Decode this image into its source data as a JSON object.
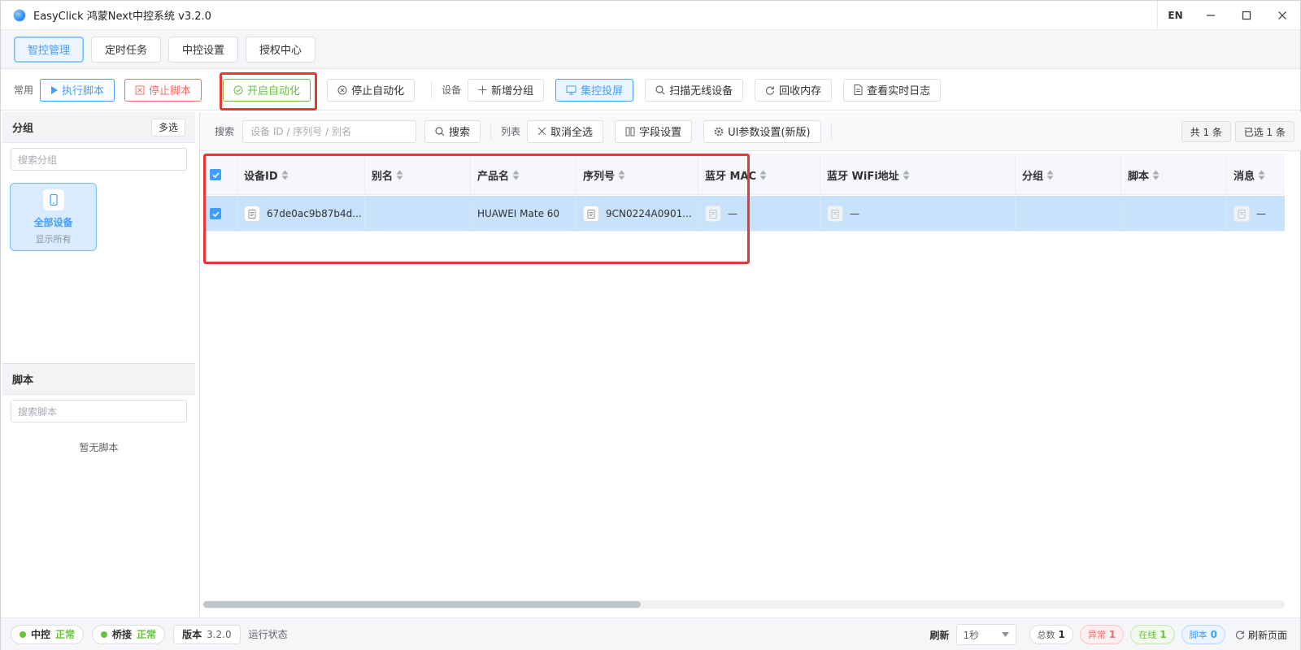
{
  "window": {
    "title": "EasyClick 鸿蒙Next中控系统 v3.2.0",
    "lang": "EN"
  },
  "nav": {
    "tabs": [
      {
        "label": "智控管理",
        "active": true
      },
      {
        "label": "定时任务"
      },
      {
        "label": "中控设置"
      },
      {
        "label": "授权中心"
      }
    ]
  },
  "toolbar": {
    "common_label": "常用",
    "run_script": "执行脚本",
    "stop_script": "停止脚本",
    "start_auto": "开启自动化",
    "stop_auto": "停止自动化",
    "device_label": "设备",
    "add_group": "新增分组",
    "group_screen": "集控投屏",
    "scan_wireless": "扫描无线设备",
    "reclaim_memory": "回收内存",
    "view_logs": "查看实时日志"
  },
  "sidebar": {
    "group_title": "分组",
    "multi_select": "多选",
    "group_search_placeholder": "搜索分组",
    "group_card": {
      "name": "全部设备",
      "sub": "显示所有"
    },
    "script_title": "脚本",
    "script_search_placeholder": "搜索脚本",
    "script_empty": "暂无脚本"
  },
  "filter": {
    "search_label": "搜索",
    "search_placeholder": "设备 ID / 序列号 / 别名",
    "search_button": "搜索",
    "list_label": "列表",
    "deselect_all": "取消全选",
    "field_settings": "字段设置",
    "ui_params": "UI参数设置(新版)",
    "total": "共 1 条",
    "selected": "已选 1 条"
  },
  "table": {
    "columns": [
      "设备ID",
      "别名",
      "产品名",
      "序列号",
      "蓝牙 MAC",
      "蓝牙 WiFi地址",
      "分组",
      "脚本",
      "消息"
    ],
    "rows": [
      {
        "device_id": "67de0ac9b87b4d...",
        "alias": "",
        "product": "HUAWEI Mate 60",
        "serial": "9CN0224A0901...",
        "bt_mac": "—",
        "bt_wifi": "—",
        "group": "",
        "script": "",
        "message": "—"
      }
    ]
  },
  "statusbar": {
    "center_label": "中控",
    "center_state": "正常",
    "bridge_label": "桥接",
    "bridge_state": "正常",
    "version_label": "版本",
    "version_value": "3.2.0",
    "run_state": "运行状态",
    "refresh_label": "刷新",
    "refresh_value": "1秒",
    "total_label": "总数",
    "total_value": "1",
    "error_label": "异常",
    "error_value": "1",
    "online_label": "在线",
    "online_value": "1",
    "script_label": "脚本",
    "script_value": "0",
    "refresh_page": "刷新页面"
  },
  "colors": {
    "primary": "#409eff",
    "danger": "#f56c6c",
    "success": "#67c23a",
    "highlight_box": "#e53935",
    "selected_row": "#c9e2fb"
  }
}
